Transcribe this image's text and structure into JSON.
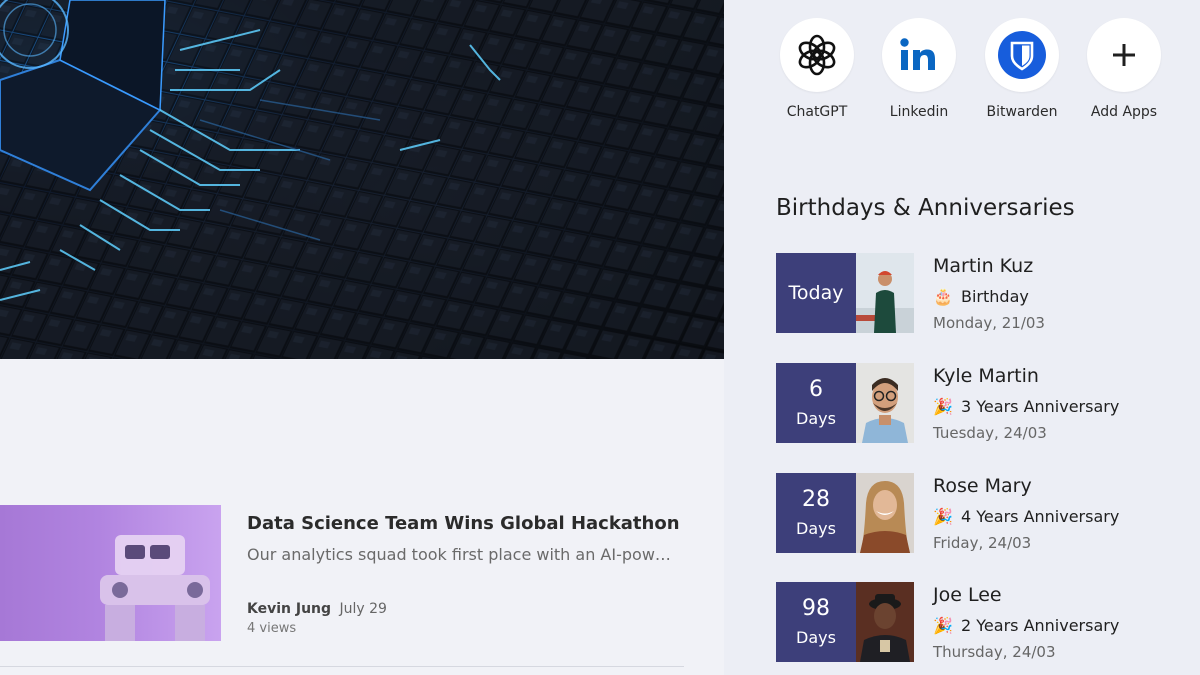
{
  "news": {
    "title": "Data Science Team Wins Global Hackathon",
    "excerpt": "Our analytics squad took first place with an AI-powered...",
    "author": "Kevin Jung",
    "date": "July 29",
    "views": "4 views"
  },
  "apps": [
    {
      "label": "ChatGPT",
      "icon": "chatgpt-icon"
    },
    {
      "label": "Linkedin",
      "icon": "linkedin-icon"
    },
    {
      "label": "Bitwarden",
      "icon": "bitwarden-icon"
    },
    {
      "label": "Add Apps",
      "icon": "plus-icon"
    }
  ],
  "celebrations": {
    "title": "Birthdays & Anniversaries",
    "items": [
      {
        "count": "Today",
        "unit": "",
        "name": "Martin Kuz",
        "emoji": "🎂",
        "type": "Birthday",
        "date": "Monday, 21/03"
      },
      {
        "count": "6",
        "unit": "Days",
        "name": "Kyle Martin",
        "emoji": "🎉",
        "type": "3 Years Anniversary",
        "date": "Tuesday, 24/03"
      },
      {
        "count": "28",
        "unit": "Days",
        "name": "Rose Mary",
        "emoji": "🎉",
        "type": "4 Years Anniversary",
        "date": "Friday, 24/03"
      },
      {
        "count": "98",
        "unit": "Days",
        "name": "Joe Lee",
        "emoji": "🎉",
        "type": "2 Years Anniversary",
        "date": "Thursday, 24/03"
      }
    ]
  },
  "colors": {
    "badge_bg": "#3d3f7a",
    "bitwarden_blue": "#175ddc",
    "linkedin_blue": "#0a66c2",
    "panel_bg": "#eceef5"
  }
}
